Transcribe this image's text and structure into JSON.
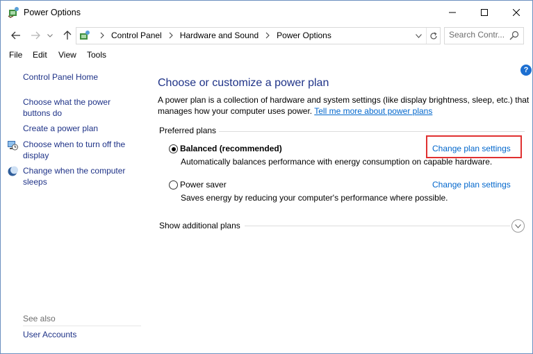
{
  "window": {
    "title": "Power Options"
  },
  "address_bar": {
    "breadcrumbs": [
      "Control Panel",
      "Hardware and Sound",
      "Power Options"
    ]
  },
  "search": {
    "placeholder": "Search Contr..."
  },
  "menu": {
    "items": [
      "File",
      "Edit",
      "View",
      "Tools"
    ]
  },
  "sidebar": {
    "home": "Control Panel Home",
    "items": [
      {
        "label": "Choose what the power buttons do",
        "icon": "none"
      },
      {
        "label": "Create a power plan",
        "icon": "none"
      },
      {
        "label": "Choose when to turn off the display",
        "icon": "monitor-clock-icon"
      },
      {
        "label": "Change when the computer sleeps",
        "icon": "moon-icon"
      }
    ],
    "see_also": "See also",
    "see_also_links": [
      "User Accounts"
    ]
  },
  "main": {
    "heading": "Choose or customize a power plan",
    "description": "A power plan is a collection of hardware and system settings (like display brightness, sleep, etc.) that manages how your computer uses power.",
    "learn_more_link": "Tell me more about power plans",
    "preferred_label": "Preferred plans",
    "plans": [
      {
        "name": "Balanced (recommended)",
        "selected": true,
        "link": "Change plan settings",
        "description": "Automatically balances performance with energy consumption on capable hardware."
      },
      {
        "name": "Power saver",
        "selected": false,
        "link": "Change plan settings",
        "description": "Saves energy by reducing your computer's performance where possible."
      }
    ],
    "additional_plans_label": "Show additional plans"
  },
  "colors": {
    "link": "#1e3287",
    "hyperlink": "#0066cc",
    "highlight_box": "#e03030",
    "help_icon": "#1c6fd1"
  }
}
